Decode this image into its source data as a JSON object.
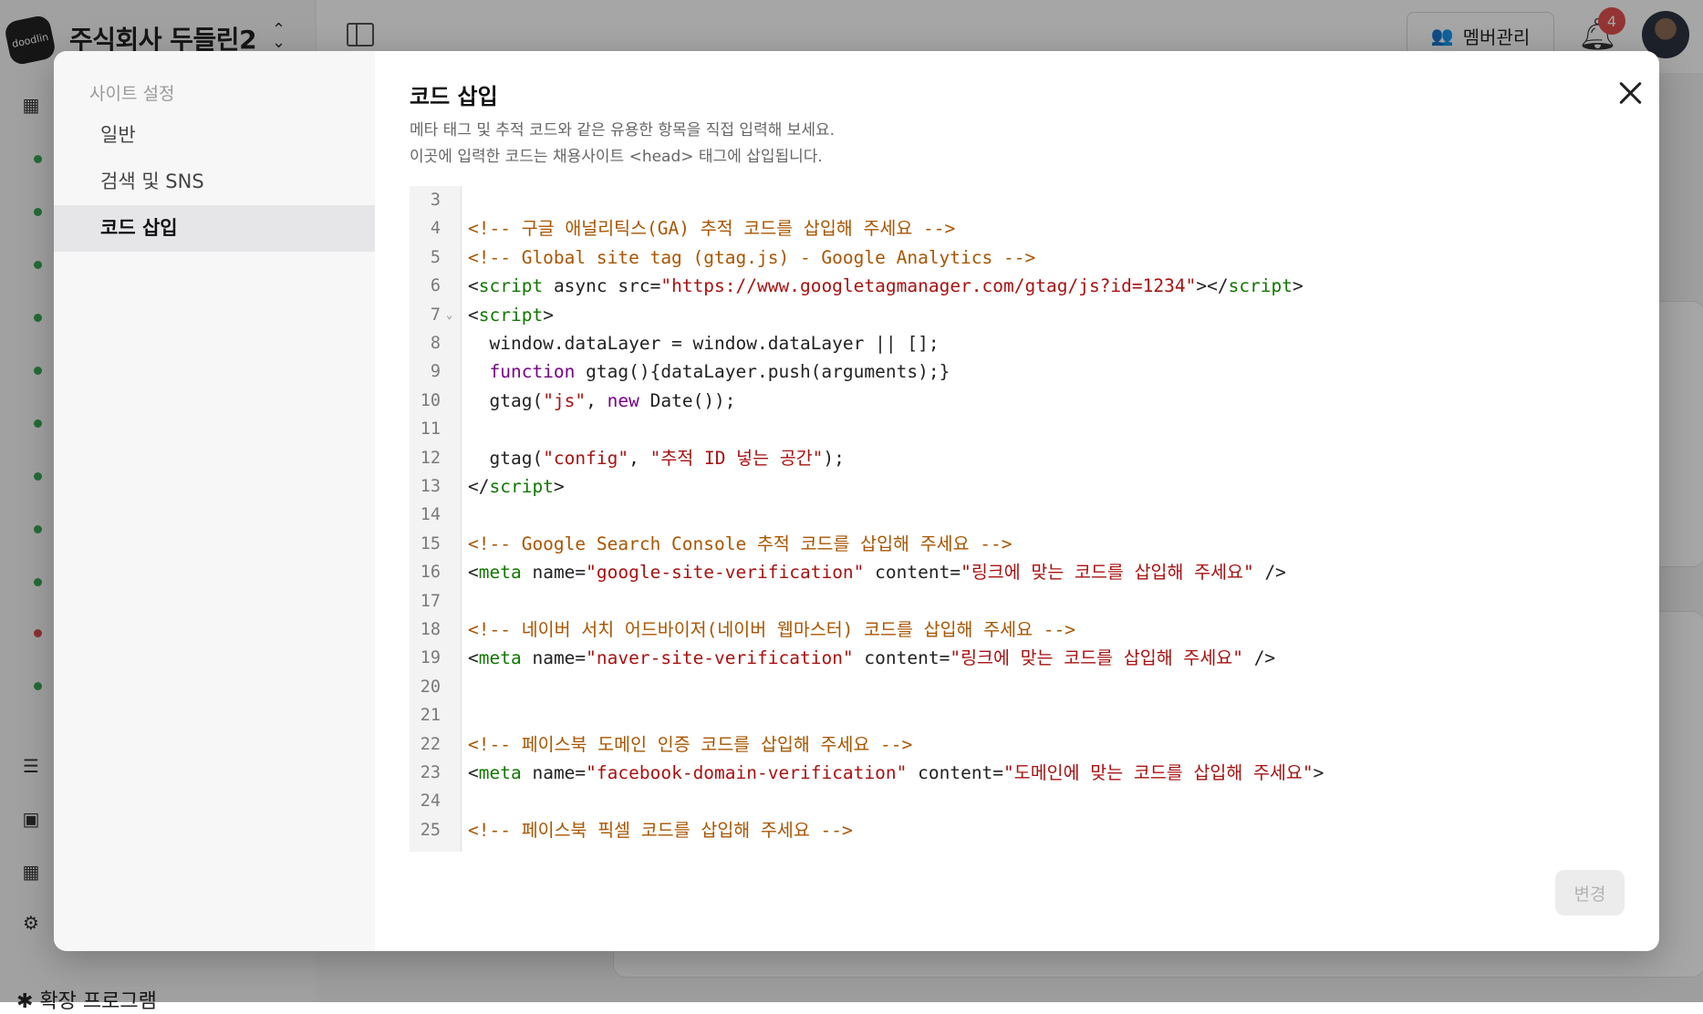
{
  "header": {
    "logo_text": "doodlin",
    "company_name": "주식회사 두들린2",
    "switch_icon": "updown-chevron-icon",
    "member_button_label": "멤버관리",
    "notification_count": "4"
  },
  "app_sidebar": {
    "footer_label": "확장 프로그램"
  },
  "modal": {
    "nav": {
      "heading": "사이트 설정",
      "items": [
        {
          "label": "일반"
        },
        {
          "label": "검색 및 SNS"
        },
        {
          "label": "코드 삽입"
        }
      ],
      "active_index": 2
    },
    "title": "코드 삽입",
    "description_lines": [
      "메타 태그 및 추적 코드와 같은 유용한 항목을 직접 입력해 보세요.",
      "이곳에 입력한 코드는 채용사이트 <head> 태그에 삽입됩니다."
    ],
    "submit_label": "변경",
    "code": {
      "lines": [
        {
          "n": "3",
          "parts": []
        },
        {
          "n": "4",
          "parts": [
            {
              "t": "<!-- 구글 애널리틱스(GA) 추적 코드를 삽입해 주세요 -->",
              "c": "cm"
            }
          ]
        },
        {
          "n": "5",
          "parts": [
            {
              "t": "<!-- Global site tag (gtag.js) - Google Analytics -->",
              "c": "cm"
            }
          ]
        },
        {
          "n": "6",
          "parts": [
            {
              "t": "<",
              "c": ""
            },
            {
              "t": "script",
              "c": "tg"
            },
            {
              "t": " async src=",
              "c": ""
            },
            {
              "t": "\"https://www.googletagmanager.com/gtag/js?id=1234\"",
              "c": "st"
            },
            {
              "t": "></",
              "c": ""
            },
            {
              "t": "script",
              "c": "tg"
            },
            {
              "t": ">",
              "c": ""
            }
          ]
        },
        {
          "n": "7",
          "fold": true,
          "parts": [
            {
              "t": "<",
              "c": ""
            },
            {
              "t": "script",
              "c": "tg"
            },
            {
              "t": ">",
              "c": ""
            }
          ]
        },
        {
          "n": "8",
          "parts": [
            {
              "t": "  window.dataLayer = window.dataLayer || [];",
              "c": ""
            }
          ]
        },
        {
          "n": "9",
          "parts": [
            {
              "t": "  ",
              "c": ""
            },
            {
              "t": "function",
              "c": "kw"
            },
            {
              "t": " gtag(){dataLayer.push(arguments);}",
              "c": ""
            }
          ]
        },
        {
          "n": "10",
          "parts": [
            {
              "t": "  gtag(",
              "c": ""
            },
            {
              "t": "\"js\"",
              "c": "st"
            },
            {
              "t": ", ",
              "c": ""
            },
            {
              "t": "new",
              "c": "kw"
            },
            {
              "t": " Date());",
              "c": ""
            }
          ]
        },
        {
          "n": "11",
          "parts": []
        },
        {
          "n": "12",
          "parts": [
            {
              "t": "  gtag(",
              "c": ""
            },
            {
              "t": "\"config\"",
              "c": "st"
            },
            {
              "t": ", ",
              "c": ""
            },
            {
              "t": "\"추적 ID 넣는 공간\"",
              "c": "st"
            },
            {
              "t": ");",
              "c": ""
            }
          ]
        },
        {
          "n": "13",
          "parts": [
            {
              "t": "</",
              "c": ""
            },
            {
              "t": "script",
              "c": "tg"
            },
            {
              "t": ">",
              "c": ""
            }
          ]
        },
        {
          "n": "14",
          "parts": []
        },
        {
          "n": "15",
          "parts": [
            {
              "t": "<!-- Google Search Console 추적 코드를 삽입해 주세요 -->",
              "c": "cm"
            }
          ]
        },
        {
          "n": "16",
          "parts": [
            {
              "t": "<",
              "c": ""
            },
            {
              "t": "meta",
              "c": "tg"
            },
            {
              "t": " name=",
              "c": ""
            },
            {
              "t": "\"google-site-verification\"",
              "c": "st"
            },
            {
              "t": " content=",
              "c": ""
            },
            {
              "t": "\"링크에 맞는 코드를 삽입해 주세요\"",
              "c": "st"
            },
            {
              "t": " />",
              "c": ""
            }
          ]
        },
        {
          "n": "17",
          "parts": []
        },
        {
          "n": "18",
          "parts": [
            {
              "t": "<!-- 네이버 서치 어드바이저(네이버 웹마스터) 코드를 삽입해 주세요 -->",
              "c": "cm"
            }
          ]
        },
        {
          "n": "19",
          "parts": [
            {
              "t": "<",
              "c": ""
            },
            {
              "t": "meta",
              "c": "tg"
            },
            {
              "t": " name=",
              "c": ""
            },
            {
              "t": "\"naver-site-verification\"",
              "c": "st"
            },
            {
              "t": " content=",
              "c": ""
            },
            {
              "t": "\"링크에 맞는 코드를 삽입해 주세요\"",
              "c": "st"
            },
            {
              "t": " />",
              "c": ""
            }
          ]
        },
        {
          "n": "20",
          "parts": []
        },
        {
          "n": "21",
          "parts": []
        },
        {
          "n": "22",
          "parts": [
            {
              "t": "<!-- 페이스북 도메인 인증 코드를 삽입해 주세요 -->",
              "c": "cm"
            }
          ]
        },
        {
          "n": "23",
          "parts": [
            {
              "t": "<",
              "c": ""
            },
            {
              "t": "meta",
              "c": "tg"
            },
            {
              "t": " name=",
              "c": ""
            },
            {
              "t": "\"facebook-domain-verification\"",
              "c": "st"
            },
            {
              "t": " content=",
              "c": ""
            },
            {
              "t": "\"도메인에 맞는 코드를 삽입해 주세요\"",
              "c": "st"
            },
            {
              "t": ">",
              "c": ""
            }
          ]
        },
        {
          "n": "24",
          "parts": []
        },
        {
          "n": "25",
          "parts": [
            {
              "t": "<!-- 페이스북 픽셀 코드를 삽입해 주세요 -->",
              "c": "cm"
            }
          ]
        }
      ]
    }
  }
}
